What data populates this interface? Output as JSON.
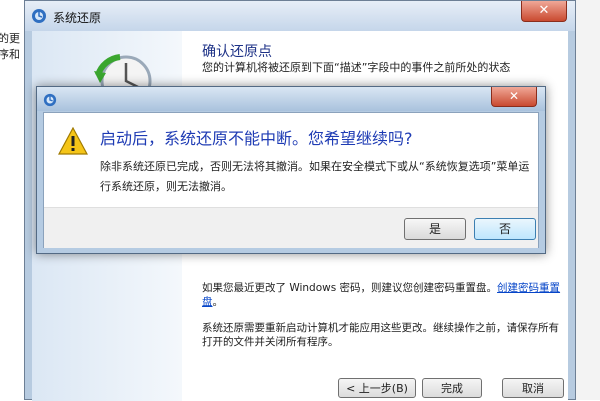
{
  "background": {
    "fragment1": "的更",
    "fragment2": "序和"
  },
  "main_window": {
    "title": "系统还原",
    "close_glyph": "✕",
    "heading": "确认还原点",
    "description": "您的计算机将被还原到下面“描述”字段中的事件之前所处的状态",
    "note1_prefix": "如果您最近更改了 Windows 密码，则建议您创建密码重置盘。",
    "note1_link": "创建密码重置盘",
    "note1_suffix": "。",
    "note2": "系统还原需要重新启动计算机才能应用这些更改。继续操作之前，请保存所有打开的文件并关闭所有程序。",
    "back_button": "< 上一步(B)",
    "finish_button": "完成",
    "cancel_button": "取消"
  },
  "dialog": {
    "close_glyph": "✕",
    "heading": "启动后，系统还原不能中断。您希望继续吗?",
    "text": "除非系统还原已完成，否则无法将其撤消。如果在安全模式下或从“系统恢复选项”菜单运行系统还原，则无法撤消。",
    "yes_button": "是",
    "no_button": "否"
  },
  "colors": {
    "heading_blue": "#1e3bb4",
    "link_blue": "#0645c8",
    "warning_yellow": "#f5c518",
    "close_red": "#c94a30"
  },
  "icons": [
    "system-restore-icon",
    "clock-icon",
    "warning-icon",
    "close-icon"
  ]
}
